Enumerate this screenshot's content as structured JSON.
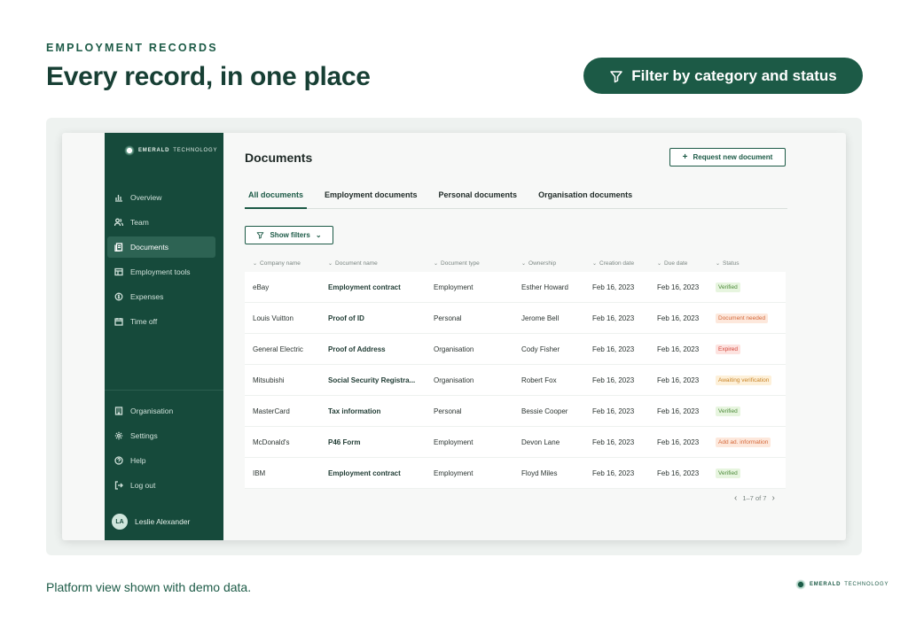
{
  "header": {
    "eyebrow": "EMPLOYMENT RECORDS",
    "headline": "Every record, in one place",
    "filter_pill": "Filter by category and status"
  },
  "sidebar": {
    "logo_bold": "EMERALD",
    "logo_light": "TECHNOLOGY",
    "items": [
      {
        "label": "Overview",
        "icon": "bar-chart-icon"
      },
      {
        "label": "Team",
        "icon": "team-icon"
      },
      {
        "label": "Documents",
        "icon": "documents-icon",
        "active": true
      },
      {
        "label": "Employment tools",
        "icon": "tools-icon"
      },
      {
        "label": "Expenses",
        "icon": "expenses-icon"
      },
      {
        "label": "Time off",
        "icon": "calendar-icon"
      }
    ],
    "bottom_items": [
      {
        "label": "Organisation",
        "icon": "building-icon"
      },
      {
        "label": "Settings",
        "icon": "gear-icon"
      },
      {
        "label": "Help",
        "icon": "help-icon"
      },
      {
        "label": "Log out",
        "icon": "logout-icon"
      }
    ],
    "user": {
      "initials": "LA",
      "name": "Leslie Alexander"
    }
  },
  "main": {
    "title": "Documents",
    "request_button": "Request new document",
    "tabs": [
      "All documents",
      "Employment documents",
      "Personal documents",
      "Organisation documents"
    ],
    "show_filters": "Show filters",
    "columns": [
      "Company name",
      "Document name",
      "Document type",
      "Ownership",
      "Creation date",
      "Due date",
      "Status"
    ],
    "rows": [
      {
        "company": "eBay",
        "document": "Employment contract",
        "type": "Employment",
        "owner": "Esther Howard",
        "created": "Feb 16, 2023",
        "due": "Feb 16, 2023",
        "status": "Verified",
        "status_kind": "verified"
      },
      {
        "company": "Louis Vuitton",
        "document": "Proof of ID",
        "type": "Personal",
        "owner": "Jerome Bell",
        "created": "Feb 16, 2023",
        "due": "Feb 16, 2023",
        "status": "Document needed",
        "status_kind": "needed"
      },
      {
        "company": "General Electric",
        "document": "Proof of Address",
        "type": "Organisation",
        "owner": "Cody Fisher",
        "created": "Feb 16, 2023",
        "due": "Feb 16, 2023",
        "status": "Expired",
        "status_kind": "expired"
      },
      {
        "company": "Mitsubishi",
        "document": "Social Security Registra...",
        "type": "Organisation",
        "owner": "Robert Fox",
        "created": "Feb 16, 2023",
        "due": "Feb 16, 2023",
        "status": "Awaiting verification",
        "status_kind": "awaiting"
      },
      {
        "company": "MasterCard",
        "document": "Tax information",
        "type": "Personal",
        "owner": "Bessie Cooper",
        "created": "Feb 16, 2023",
        "due": "Feb 16, 2023",
        "status": "Verified",
        "status_kind": "verified"
      },
      {
        "company": "McDonald's",
        "document": "P46 Form",
        "type": "Employment",
        "owner": "Devon Lane",
        "created": "Feb 16, 2023",
        "due": "Feb 16, 2023",
        "status": "Add ad. information",
        "status_kind": "addl"
      },
      {
        "company": "IBM",
        "document": "Employment contract",
        "type": "Employment",
        "owner": "Floyd Miles",
        "created": "Feb 16, 2023",
        "due": "Feb 16, 2023",
        "status": "Verified",
        "status_kind": "verified"
      }
    ],
    "pagination": "1–7 of 7"
  },
  "footer": {
    "note": "Platform view shown with demo data.",
    "brand_bold": "EMERALD",
    "brand_light": "TECHNOLOGY"
  },
  "colors": {
    "brand_green": "#1c5a46",
    "sidebar_bg": "#164a3b",
    "verified": "#4c8a3a",
    "warning": "#d4683a",
    "error": "#d2453a"
  }
}
